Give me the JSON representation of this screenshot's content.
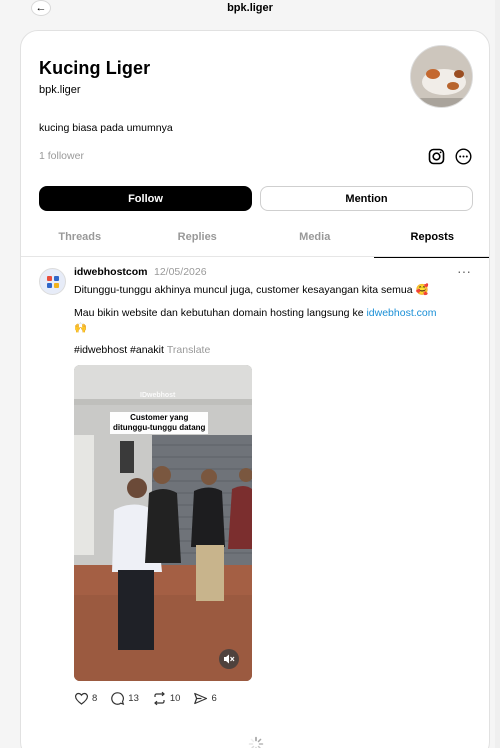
{
  "header": {
    "title": "bpk.liger"
  },
  "profile": {
    "name": "Kucing Liger",
    "handle": "bpk.liger",
    "bio": "kucing biasa pada umumnya",
    "followers": "1 follower",
    "follow_label": "Follow",
    "mention_label": "Mention"
  },
  "tabs": [
    {
      "label": "Threads"
    },
    {
      "label": "Replies"
    },
    {
      "label": "Media"
    },
    {
      "label": "Reposts"
    }
  ],
  "active_tab": "Reposts",
  "post": {
    "author": "idwebhostcom",
    "date": "12/05/2026",
    "menu": "···",
    "line1": "Ditunggu-tunggu akhinya muncul juga, customer kesayangan kita semua 🥰",
    "line2_prefix": "Mau bikin website dan kebutuhan domain hosting langsung ke ",
    "line2_link": "idwebhost.com",
    "line2_suffix": "🙌",
    "hashtags": "#idwebhost #anakit",
    "translate": "Translate",
    "media_caption_line1": "Customer yang",
    "media_caption_line2": "ditunggu-tunggu datang",
    "media_watermark": "IDwebhost",
    "likes": "8",
    "replies": "13",
    "reposts": "10",
    "shares": "6"
  },
  "colors": {
    "accent_link": "#1a8fd6",
    "follow_bg": "#000000",
    "muted_text": "#999999"
  }
}
